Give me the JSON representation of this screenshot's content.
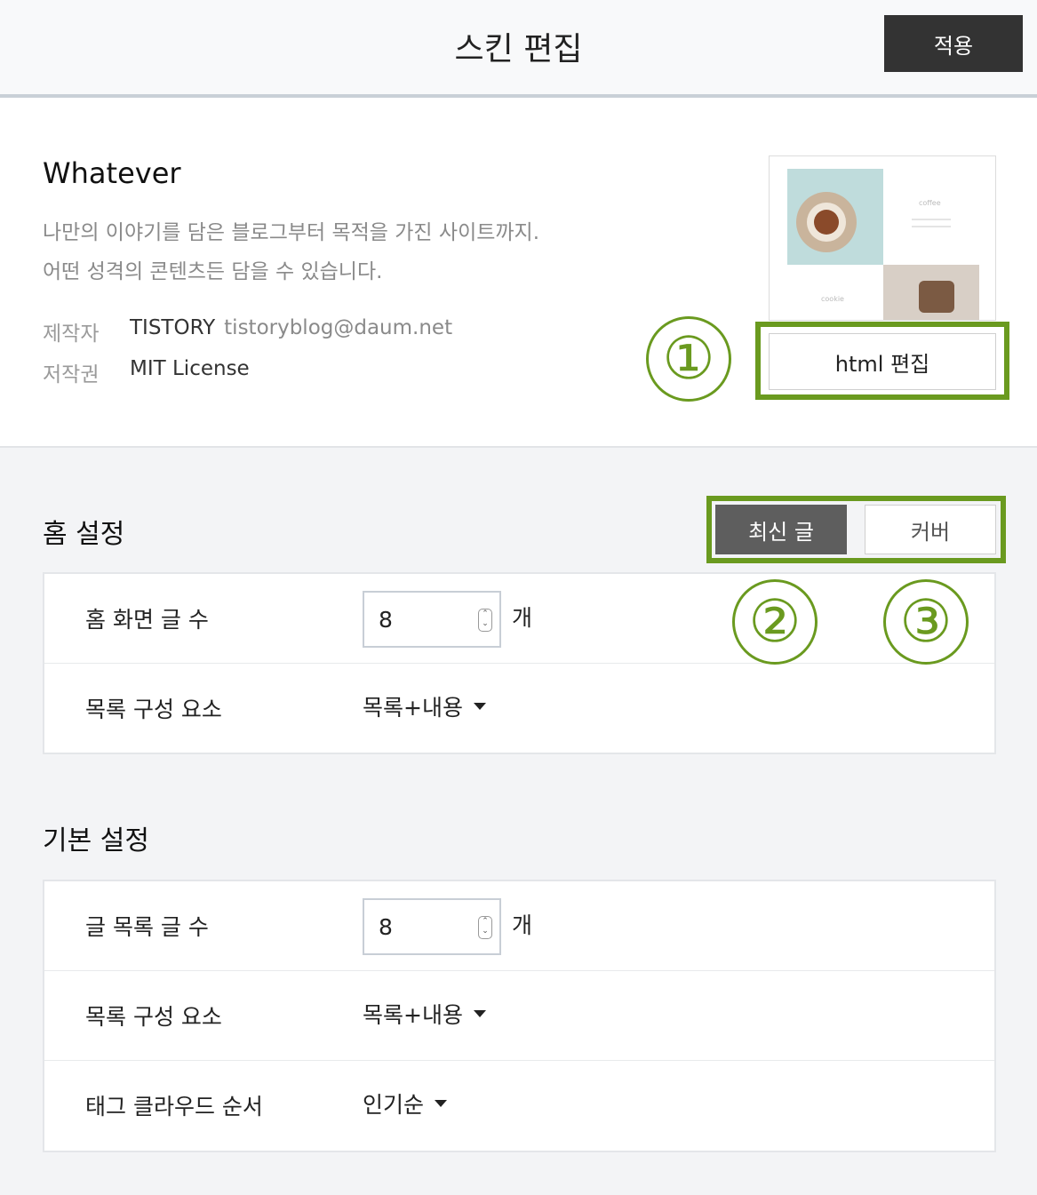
{
  "header": {
    "title": "스킨 편집",
    "apply_label": "적용"
  },
  "skin": {
    "name": "Whatever",
    "desc_line1": "나만의 이야기를 담은 블로그부터 목적을 가진 사이트까지.",
    "desc_line2": "어떤 성격의 콘텐츠든 담을 수 있습니다.",
    "author_label": "제작자",
    "author_name": "TISTORY",
    "author_email": "tistoryblog@daum.net",
    "license_label": "저작권",
    "license_value": "MIT License",
    "thumb_coffee": "coffee",
    "thumb_cookie": "cookie",
    "html_edit_label": "html 편집"
  },
  "annotations": {
    "one": "①",
    "two": "②",
    "three": "③",
    "color": "#6a9a1f"
  },
  "home": {
    "title": "홈 설정",
    "tab_latest": "최신 글",
    "tab_cover": "커버",
    "rows": [
      {
        "label": "홈 화면 글 수",
        "value": "8",
        "unit": "개"
      },
      {
        "label": "목록 구성 요소",
        "value": "목록+내용"
      }
    ]
  },
  "basic": {
    "title": "기본 설정",
    "rows": [
      {
        "label": "글 목록 글 수",
        "value": "8",
        "unit": "개"
      },
      {
        "label": "목록 구성 요소",
        "value": "목록+내용"
      },
      {
        "label": "태그 클라우드 순서",
        "value": "인기순"
      }
    ]
  }
}
